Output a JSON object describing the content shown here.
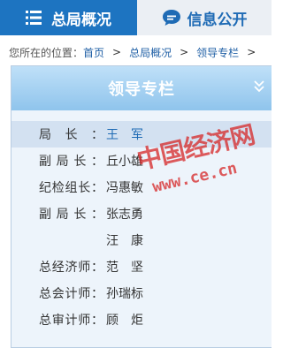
{
  "tabs": [
    {
      "label": "总局概况",
      "icon": "menu-list-icon",
      "active": true
    },
    {
      "label": "信息公开",
      "icon": "chat-bubble-icon",
      "active": false
    }
  ],
  "breadcrumb": {
    "prefix": "您所在的位置：",
    "items": [
      "首页",
      "总局概况",
      "领导专栏"
    ],
    "separator": ">"
  },
  "panel": {
    "title": "领导专栏",
    "collapse_icon": "double-chevron-down-icon"
  },
  "leaders": [
    {
      "role": "局长：",
      "name": "王　军",
      "selected": true
    },
    {
      "role": "副局长：",
      "name": "丘小雄"
    },
    {
      "role": "纪检组长：",
      "name": "冯惠敏"
    },
    {
      "role": "副局长：",
      "name": "张志勇"
    },
    {
      "role": "",
      "name": "汪　康"
    },
    {
      "role": "总经济师：",
      "name": "范　坚"
    },
    {
      "role": "总会计师：",
      "name": "孙瑞标"
    },
    {
      "role": "总审计师：",
      "name": "顾　炬"
    }
  ],
  "watermark": {
    "cn": "中国经济网",
    "url": "www.ce.cn"
  },
  "colors": {
    "tab_active": "#1d74c1",
    "tab_inactive_text": "#1f6bb5",
    "link": "#1f5fa5",
    "panel_header": "#8fc4ec",
    "selected_row": "#d3e1f1"
  }
}
